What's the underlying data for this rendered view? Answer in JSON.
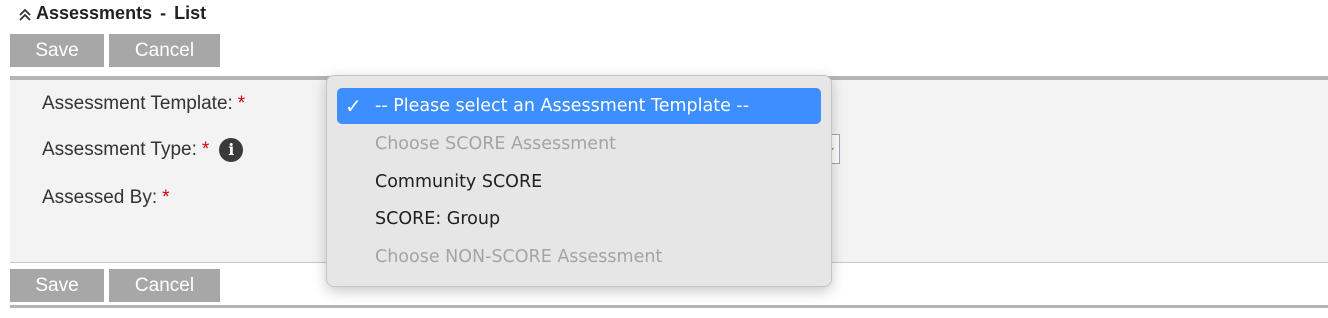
{
  "header": {
    "title": "Assessments",
    "separator": "-",
    "subtitle": "List",
    "collapse_icon": "chevron-double-up-icon"
  },
  "toolbar": {
    "save_label": "Save",
    "cancel_label": "Cancel"
  },
  "form": {
    "template_label": "Assessment Template:",
    "type_label": "Assessment Type:",
    "assessed_by_label": "Assessed By:",
    "required_marker": "*",
    "info_icon": "i"
  },
  "dropdown": {
    "check_mark": "✓",
    "options": [
      {
        "label": "-- Please select an Assessment Template --",
        "state": "selected"
      },
      {
        "label": "Choose SCORE Assessment",
        "state": "disabled"
      },
      {
        "label": "Community SCORE",
        "state": "enabled"
      },
      {
        "label": "SCORE: Group",
        "state": "enabled"
      },
      {
        "label": "Choose NON-SCORE Assessment",
        "state": "disabled"
      }
    ]
  },
  "colors": {
    "button_bg": "#a7a7a7",
    "selected_option_bg": "#3d8eff",
    "required_red": "#d40000",
    "panel_bg": "#f3f3f3"
  }
}
